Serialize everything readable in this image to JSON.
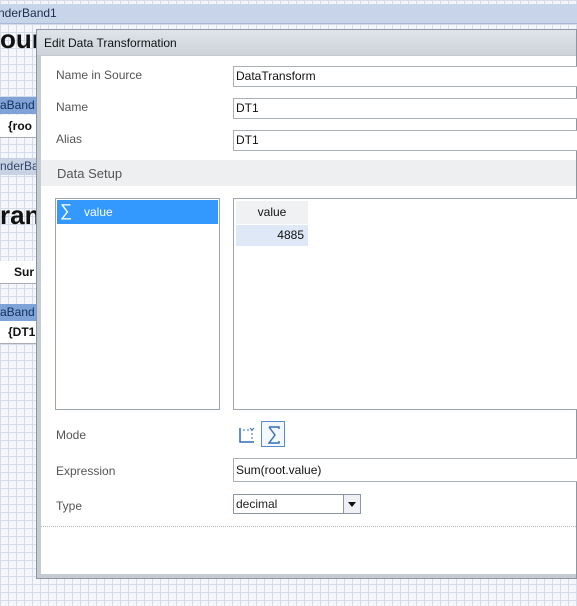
{
  "background": {
    "header_band": "nderBand1",
    "title1": "our",
    "data_band1": "aBand",
    "cell1": "{roo",
    "header_band2": "nderBa",
    "title2": "ran",
    "sum_cell": "Sur",
    "data_band2": "aBand",
    "cell2": "{DT1"
  },
  "dialog": {
    "title": "Edit Data Transformation",
    "fields": {
      "name_in_source": {
        "label": "Name in Source",
        "value": "DataTransform"
      },
      "name": {
        "label": "Name",
        "value": "DT1"
      },
      "alias": {
        "label": "Alias",
        "value": "DT1"
      }
    },
    "section_title": "Data Setup",
    "columns_list": [
      {
        "icon": "sigma-icon",
        "label": "value",
        "selected": true
      }
    ],
    "preview_grid": {
      "header": "value",
      "rows": [
        "4885"
      ]
    },
    "mode": {
      "label": "Mode",
      "options": [
        {
          "icon": "dimension-icon",
          "active": false
        },
        {
          "icon": "sigma-icon",
          "active": true
        }
      ]
    },
    "expression": {
      "label": "Expression",
      "value": "Sum(root.value)"
    },
    "type": {
      "label": "Type",
      "value": "decimal"
    }
  }
}
